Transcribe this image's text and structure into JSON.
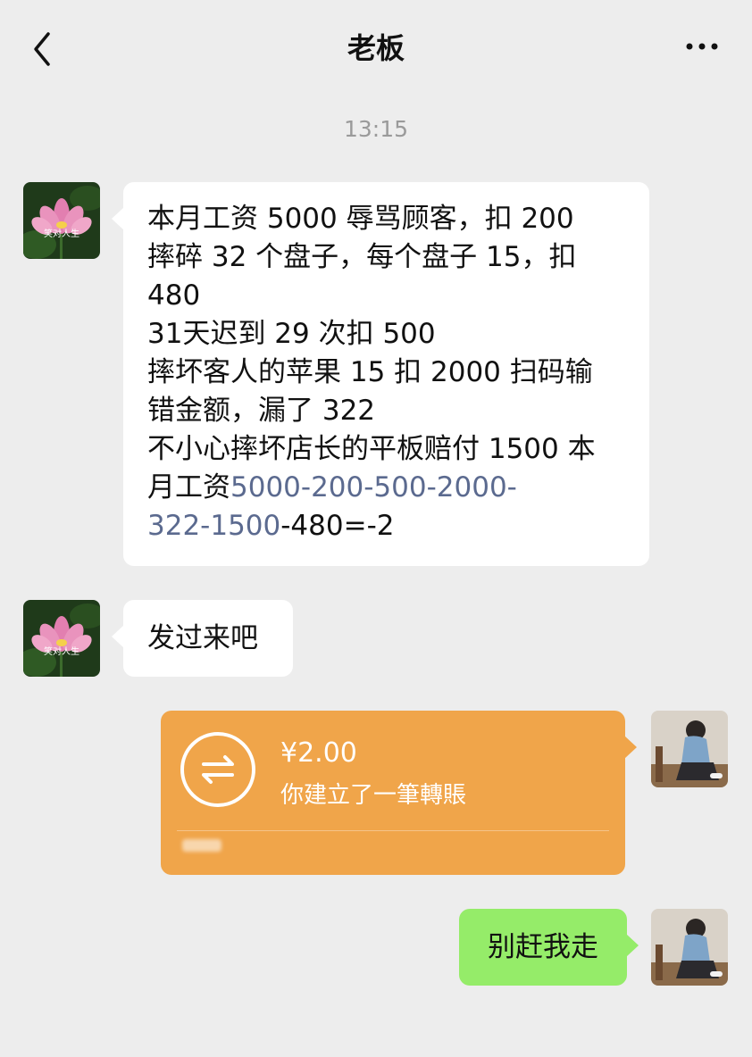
{
  "header": {
    "title": "老板",
    "back_icon": "chevron-left-icon",
    "more_icon": "more-dots-icon"
  },
  "timestamp": "13:15",
  "messages": {
    "boss_1": {
      "lines": [
        "本月工资 5000 辱骂顾客，扣 200",
        "摔碎 32 个盘子，每个盘子 15，扣",
        "480",
        "31天迟到 29 次扣 500",
        "摔坏客人的苹果 15 扣 2000 扫码输",
        "错金额，漏了 322",
        "不小心摔坏店长的平板赔付 1500 本"
      ],
      "line8_prefix": "月工资",
      "line8_highlight": "5000-200-500-2000-",
      "line9_highlight": "322-1500",
      "line9_suffix": "-480=-2"
    },
    "boss_2": {
      "text": "发过来吧"
    },
    "transfer": {
      "amount": "¥2.00",
      "description": "你建立了一筆轉賬",
      "icon": "transfer-arrows-icon"
    },
    "me_1": {
      "text": "别赶我走"
    }
  },
  "avatars": {
    "boss_caption": "笑对人生"
  },
  "colors": {
    "background": "#ededed",
    "bubble_white": "#ffffff",
    "bubble_green": "#95ec69",
    "transfer_orange": "#f0a54a",
    "highlight_link": "#5b6a8f"
  }
}
